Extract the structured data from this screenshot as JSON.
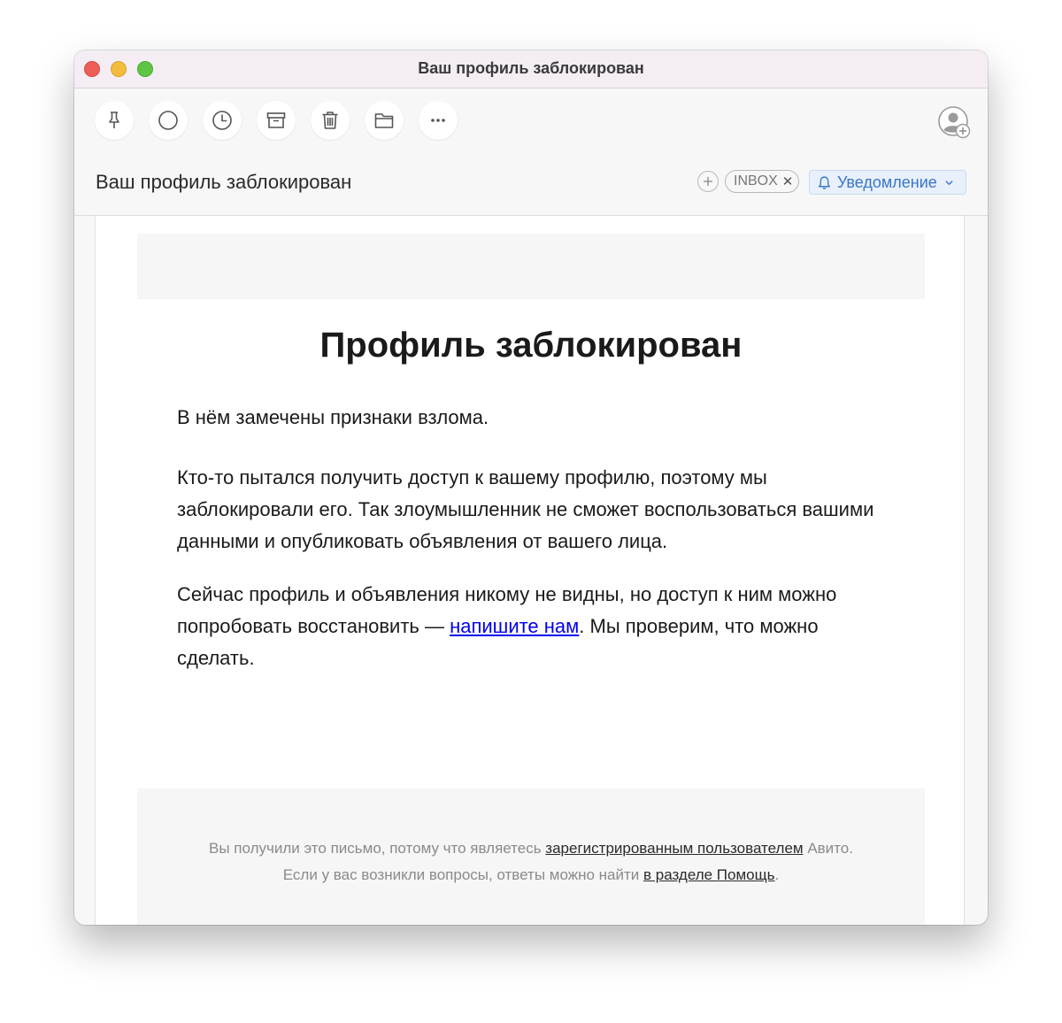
{
  "window": {
    "title": "Ваш профиль заблокирован"
  },
  "toolbar": {
    "buttons": [
      {
        "name": "pin",
        "icon": "pin-icon"
      },
      {
        "name": "mark-unread",
        "icon": "circle-icon"
      },
      {
        "name": "snooze",
        "icon": "clock-icon"
      },
      {
        "name": "archive",
        "icon": "archive-icon"
      },
      {
        "name": "delete",
        "icon": "trash-icon"
      },
      {
        "name": "move",
        "icon": "folder-icon"
      },
      {
        "name": "more",
        "icon": "ellipsis-icon"
      }
    ],
    "contact_icon": "add-contact-icon"
  },
  "subject_bar": {
    "subject": "Ваш профиль заблокирован",
    "add_tag_symbol": "+",
    "tag": "INBOX",
    "tag_remove_symbol": "✕",
    "category": "Уведомление",
    "accent_color": "#3a75c9"
  },
  "email": {
    "heading": "Профиль заблокирован",
    "paragraph1": "В нём замечены признаки взлома.",
    "paragraph2": "Кто-то пытался получить доступ к вашему профилю, поэтому мы заблокировали его. Так злоумышленник не сможет воспользоваться вашими данными и опубликовать объявления от вашего лица.",
    "paragraph3_before": "Сейчас профиль и объявления никому не видны, но доступ к ним можно попробовать восстановить — ",
    "paragraph3_link": "напишите нам",
    "paragraph3_after": ". Мы проверим, что можно сделать.",
    "link_color": "#0000ee",
    "footer": {
      "line1_before": "Вы получили это письмо, потому что являетесь ",
      "line1_link": "зарегистрированным пользователем",
      "line1_after": " Авито.",
      "line2_before": "Если у вас возникли вопросы, ответы можно найти ",
      "line2_link": "в разделе Помощь",
      "line2_after": "."
    }
  }
}
